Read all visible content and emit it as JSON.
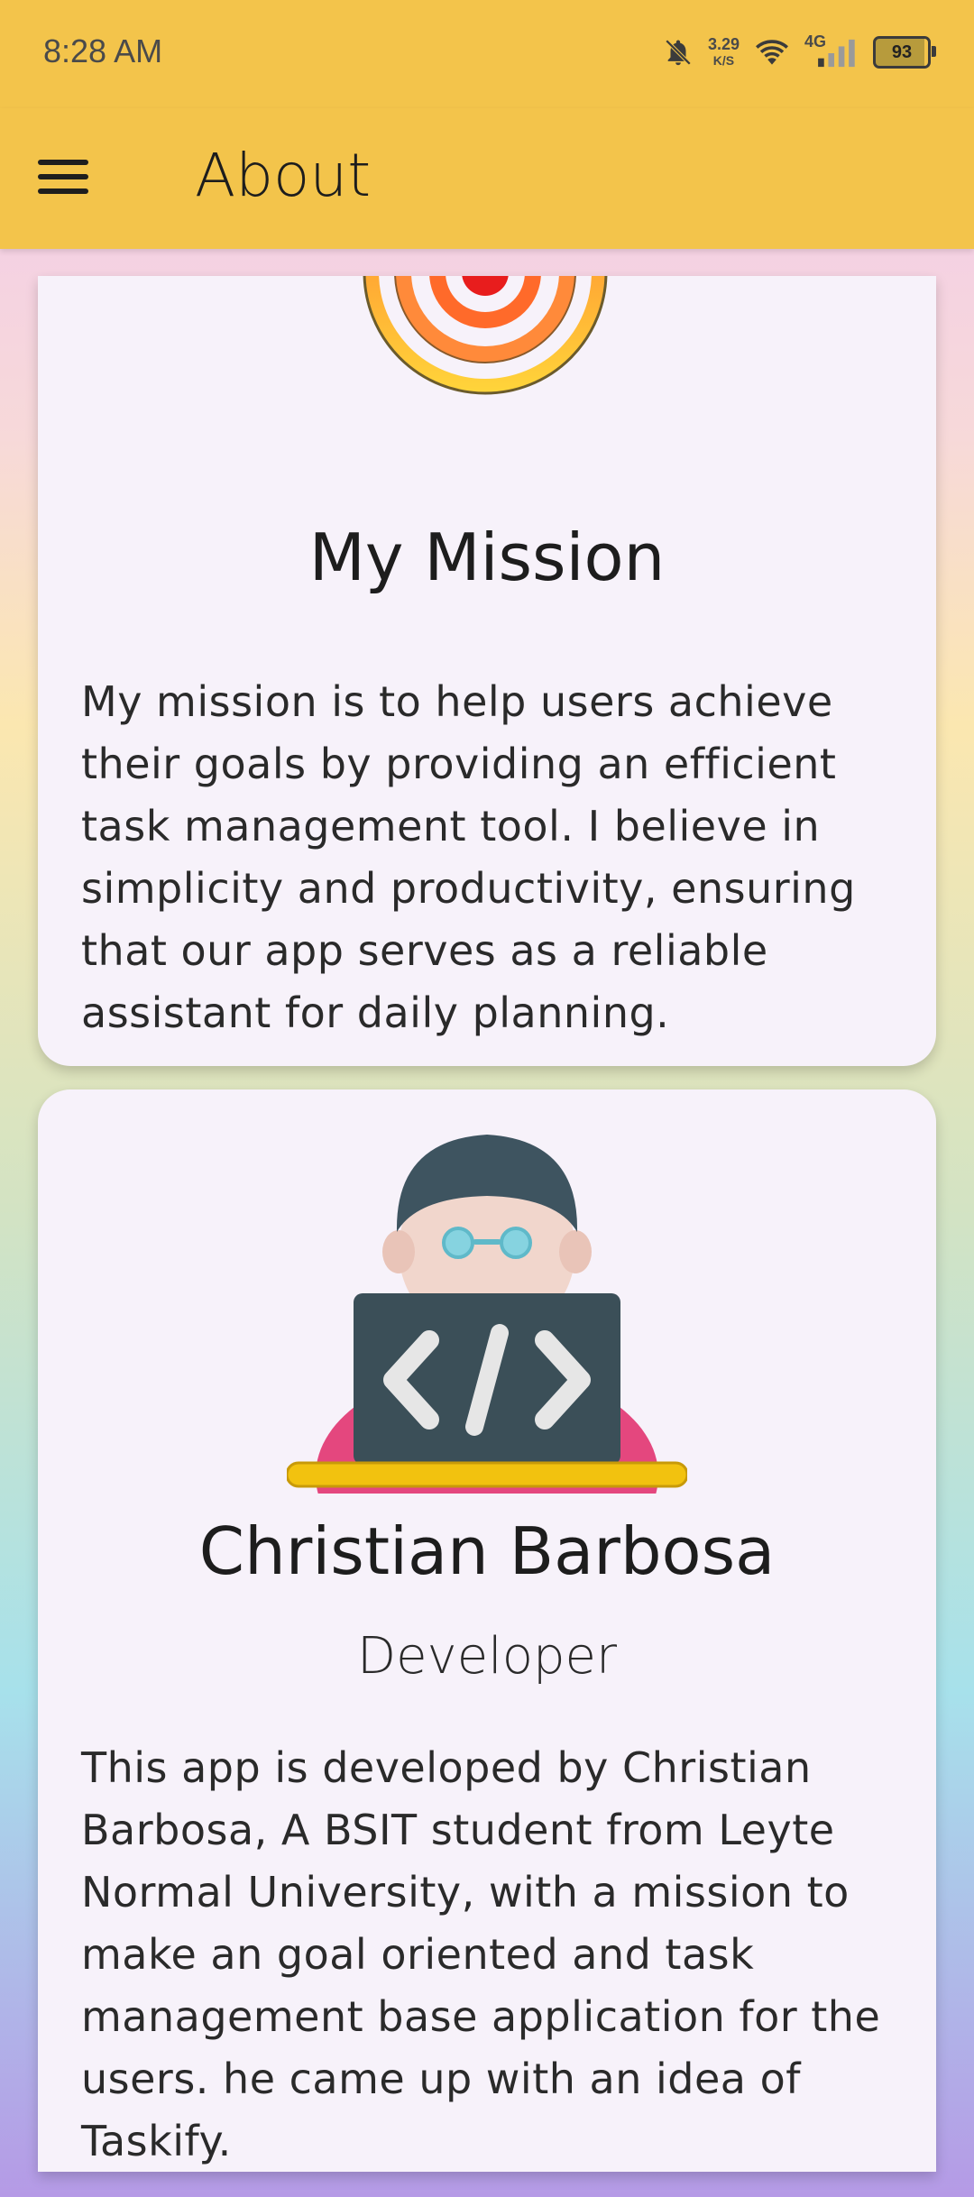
{
  "status_bar": {
    "time": "8:28 AM",
    "speed_value": "3.29",
    "speed_unit": "K/S",
    "network": "4G",
    "battery": "93"
  },
  "app_bar": {
    "title": "About"
  },
  "mission": {
    "heading": "My Mission",
    "text": "My mission is to help users achieve their goals by providing an efficient task management tool. I believe in simplicity and productivity, ensuring that our app serves as a reliable assistant for daily planning."
  },
  "developer": {
    "name": "Christian Barbosa",
    "role": "Developer",
    "text": "This app is developed by Christian Barbosa, A BSIT student from Leyte Normal University, with a mission to make an goal oriented and task management base application for the users. he came up with an idea of Taskify."
  },
  "icons": {
    "menu": "menu-icon",
    "target": "target-icon",
    "developer": "developer-avatar-icon"
  }
}
